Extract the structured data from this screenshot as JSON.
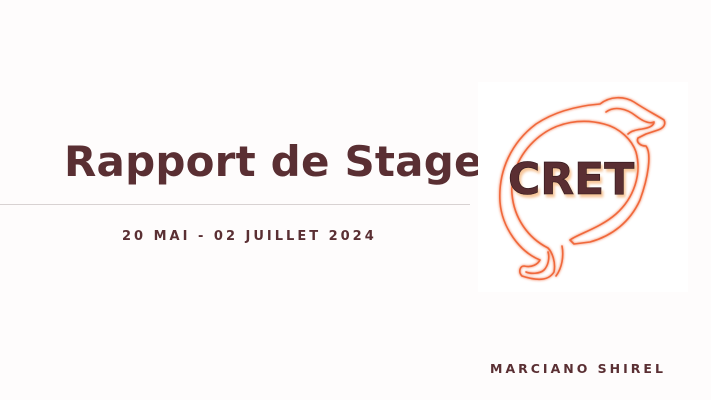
{
  "slide": {
    "title": "Rapport de Stage",
    "dates": "20 MAI - 02 JUILLET 2024",
    "author": "MARCIANO SHIREL"
  },
  "logo": {
    "text": "CRET",
    "outline_color": "#f0683a",
    "text_color": "#5a2f33"
  },
  "colors": {
    "text": "#5a2f33",
    "divider": "#d8d2d2",
    "background": "#fefcfc"
  }
}
